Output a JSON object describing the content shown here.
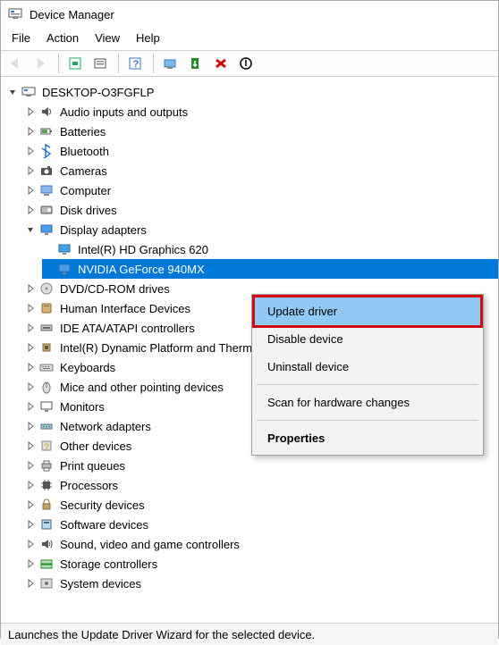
{
  "window": {
    "title": "Device Manager"
  },
  "menu": {
    "file": "File",
    "action": "Action",
    "view": "View",
    "help": "Help"
  },
  "tree": {
    "root": {
      "label": "DESKTOP-O3FGFLP"
    },
    "categories": [
      {
        "label": "Audio inputs and outputs",
        "expanded": false,
        "icon": "audio"
      },
      {
        "label": "Batteries",
        "expanded": false,
        "icon": "battery"
      },
      {
        "label": "Bluetooth",
        "expanded": false,
        "icon": "bluetooth"
      },
      {
        "label": "Cameras",
        "expanded": false,
        "icon": "camera"
      },
      {
        "label": "Computer",
        "expanded": false,
        "icon": "computer"
      },
      {
        "label": "Disk drives",
        "expanded": false,
        "icon": "disk"
      },
      {
        "label": "Display adapters",
        "expanded": true,
        "icon": "display",
        "children": [
          {
            "label": "Intel(R) HD Graphics 620",
            "icon": "display",
            "selected": false
          },
          {
            "label": "NVIDIA GeForce 940MX",
            "icon": "display",
            "selected": true
          }
        ]
      },
      {
        "label": "DVD/CD-ROM drives",
        "expanded": false,
        "icon": "cdrom"
      },
      {
        "label": "Human Interface Devices",
        "expanded": false,
        "icon": "hid"
      },
      {
        "label": "IDE ATA/ATAPI controllers",
        "expanded": false,
        "icon": "ide"
      },
      {
        "label": "Intel(R) Dynamic Platform and Thermal Framework",
        "expanded": false,
        "icon": "chip"
      },
      {
        "label": "Keyboards",
        "expanded": false,
        "icon": "keyboard"
      },
      {
        "label": "Mice and other pointing devices",
        "expanded": false,
        "icon": "mouse"
      },
      {
        "label": "Monitors",
        "expanded": false,
        "icon": "monitor"
      },
      {
        "label": "Network adapters",
        "expanded": false,
        "icon": "network"
      },
      {
        "label": "Other devices",
        "expanded": false,
        "icon": "other"
      },
      {
        "label": "Print queues",
        "expanded": false,
        "icon": "printer"
      },
      {
        "label": "Processors",
        "expanded": false,
        "icon": "cpu"
      },
      {
        "label": "Security devices",
        "expanded": false,
        "icon": "security"
      },
      {
        "label": "Software devices",
        "expanded": false,
        "icon": "software"
      },
      {
        "label": "Sound, video and game controllers",
        "expanded": false,
        "icon": "sound"
      },
      {
        "label": "Storage controllers",
        "expanded": false,
        "icon": "storage"
      },
      {
        "label": "System devices",
        "expanded": false,
        "icon": "system"
      }
    ]
  },
  "context_menu": {
    "items": [
      {
        "label": "Update driver",
        "highlight": true
      },
      {
        "label": "Disable device"
      },
      {
        "label": "Uninstall device"
      },
      {
        "sep": true
      },
      {
        "label": "Scan for hardware changes"
      },
      {
        "sep": true
      },
      {
        "label": "Properties",
        "bold": true
      }
    ]
  },
  "status": {
    "text": "Launches the Update Driver Wizard for the selected device."
  }
}
